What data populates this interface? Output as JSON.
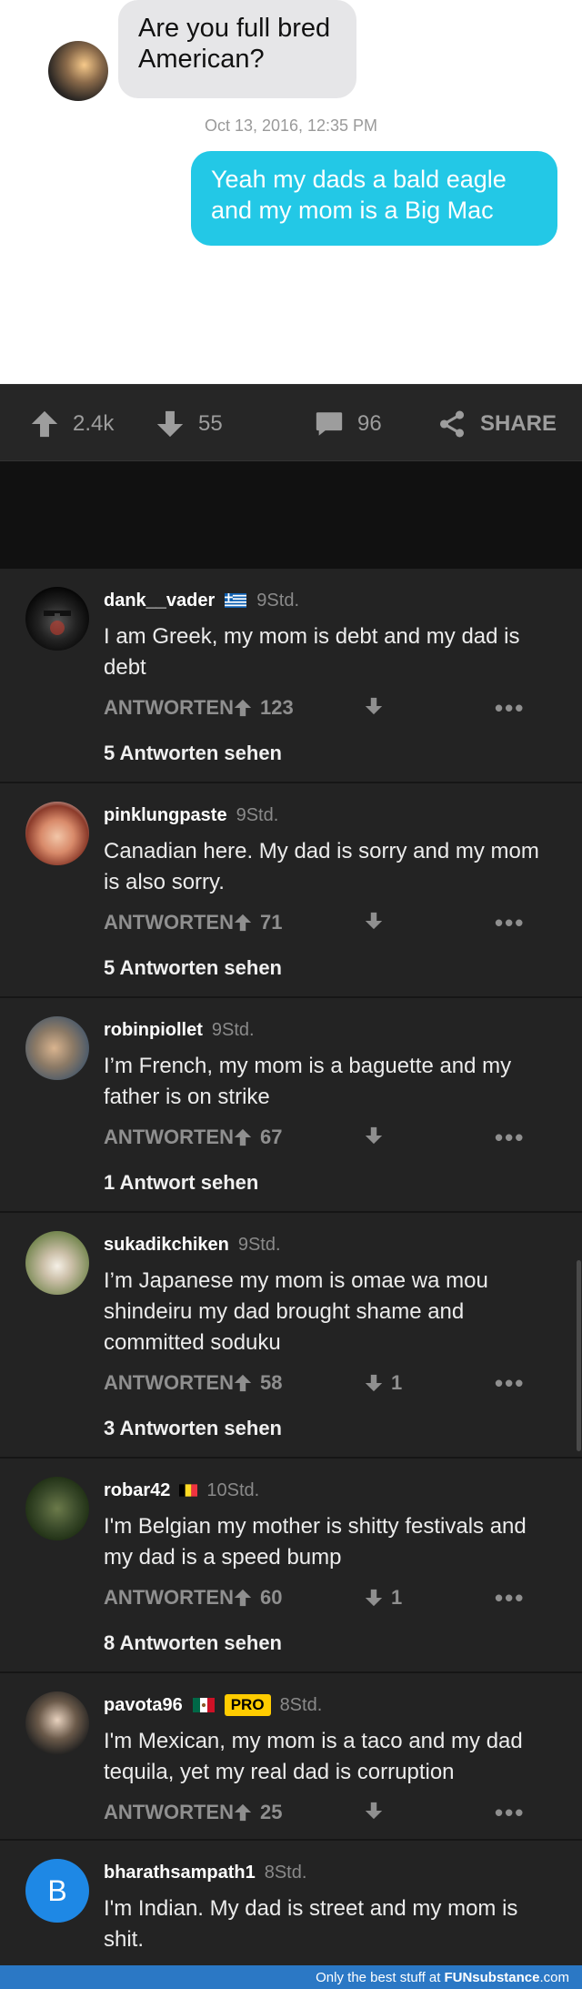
{
  "sms": {
    "incoming_text": "Are you full bred American?",
    "timestamp": "Oct 13, 2016, 12:35 PM",
    "outgoing_text": "Yeah my dads a bald eagle and my mom is a Big Mac"
  },
  "action_bar": {
    "upvotes": "2.4k",
    "downvotes": "55",
    "comments": "96",
    "share_label": "SHARE"
  },
  "comments": [
    {
      "user": "dank__vader",
      "flag": "greece",
      "time": "9Std.",
      "text": "I am Greek, my mom is debt and my dad is debt",
      "reply_label": "ANTWORTEN",
      "upvotes": "123",
      "downvotes": "",
      "more": "•••",
      "replies": "5 Antworten sehen"
    },
    {
      "user": "pinklungpaste",
      "flag": "",
      "time": "9Std.",
      "text": "Canadian here. My dad is sorry and my mom is also sorry.",
      "reply_label": "ANTWORTEN",
      "upvotes": "71",
      "downvotes": "",
      "more": "•••",
      "replies": "5 Antworten sehen"
    },
    {
      "user": "robinpiollet",
      "flag": "",
      "time": "9Std.",
      "text": "I’m French, my mom is a baguette and my father is on strike",
      "reply_label": "ANTWORTEN",
      "upvotes": "67",
      "downvotes": "",
      "more": "•••",
      "replies": "1 Antwort sehen"
    },
    {
      "user": "sukadikchiken",
      "flag": "",
      "time": "9Std.",
      "text": "I’m Japanese my mom is omae wa mou shindeiru my dad brought shame and committed soduku",
      "reply_label": "ANTWORTEN",
      "upvotes": "58",
      "downvotes": "1",
      "more": "•••",
      "replies": "3 Antworten sehen"
    },
    {
      "user": "robar42",
      "flag": "belgium",
      "time": "10Std.",
      "text": "I'm Belgian my mother is shitty festivals and my dad is a speed bump",
      "reply_label": "ANTWORTEN",
      "upvotes": "60",
      "downvotes": "1",
      "more": "•••",
      "replies": "8 Antworten sehen"
    },
    {
      "user": "pavota96",
      "flag": "mexico",
      "badge": "PRO",
      "time": "8Std.",
      "text": "I'm Mexican, my mom is a taco and my dad tequila, yet my real dad is corruption",
      "reply_label": "ANTWORTEN",
      "upvotes": "25",
      "downvotes": "",
      "more": "•••",
      "replies": ""
    },
    {
      "user": "bharathsampath1",
      "flag": "",
      "time": "8Std.",
      "avatar_letter": "B",
      "text": "I'm Indian. My dad is street and my mom is shit.",
      "reply_label": "",
      "upvotes": "",
      "downvotes": "",
      "more": "",
      "replies": ""
    }
  ],
  "footer": {
    "tagline": "Only the best stuff at",
    "brand": "FUNsubstance",
    "suffix": ".com"
  },
  "colors": {
    "incoming_bubble": "#e6e6e8",
    "outgoing_bubble": "#23c8e6",
    "pro_badge": "#ffcc00",
    "avatar_letter_bg": "#1e88e5",
    "footer_bar": "#2b78c5"
  }
}
